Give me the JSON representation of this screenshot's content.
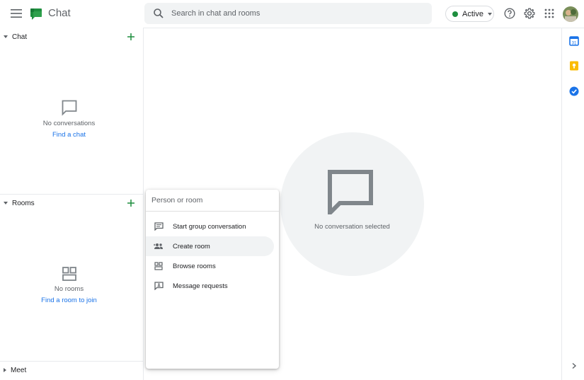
{
  "header": {
    "app_title": "Chat",
    "search_placeholder": "Search in chat and rooms",
    "status_label": "Active",
    "status_color": "#1e8e3e",
    "brand_color": "#1e8e3e"
  },
  "sidebar": {
    "chat": {
      "label": "Chat",
      "empty_text": "No conversations",
      "empty_link": "Find a chat"
    },
    "rooms": {
      "label": "Rooms",
      "empty_text": "No rooms",
      "empty_link": "Find a room to join"
    },
    "meet": {
      "label": "Meet"
    }
  },
  "main": {
    "empty_text": "No conversation selected"
  },
  "popup": {
    "input_placeholder": "Person or room",
    "items": [
      {
        "label": "Start group conversation",
        "icon": "message-icon"
      },
      {
        "label": "Create room",
        "icon": "people-icon"
      },
      {
        "label": "Browse rooms",
        "icon": "grid-icon"
      },
      {
        "label": "Message requests",
        "icon": "message-request-icon"
      }
    ]
  },
  "rail": {
    "icons": [
      "calendar-icon",
      "keep-icon",
      "tasks-icon"
    ]
  }
}
